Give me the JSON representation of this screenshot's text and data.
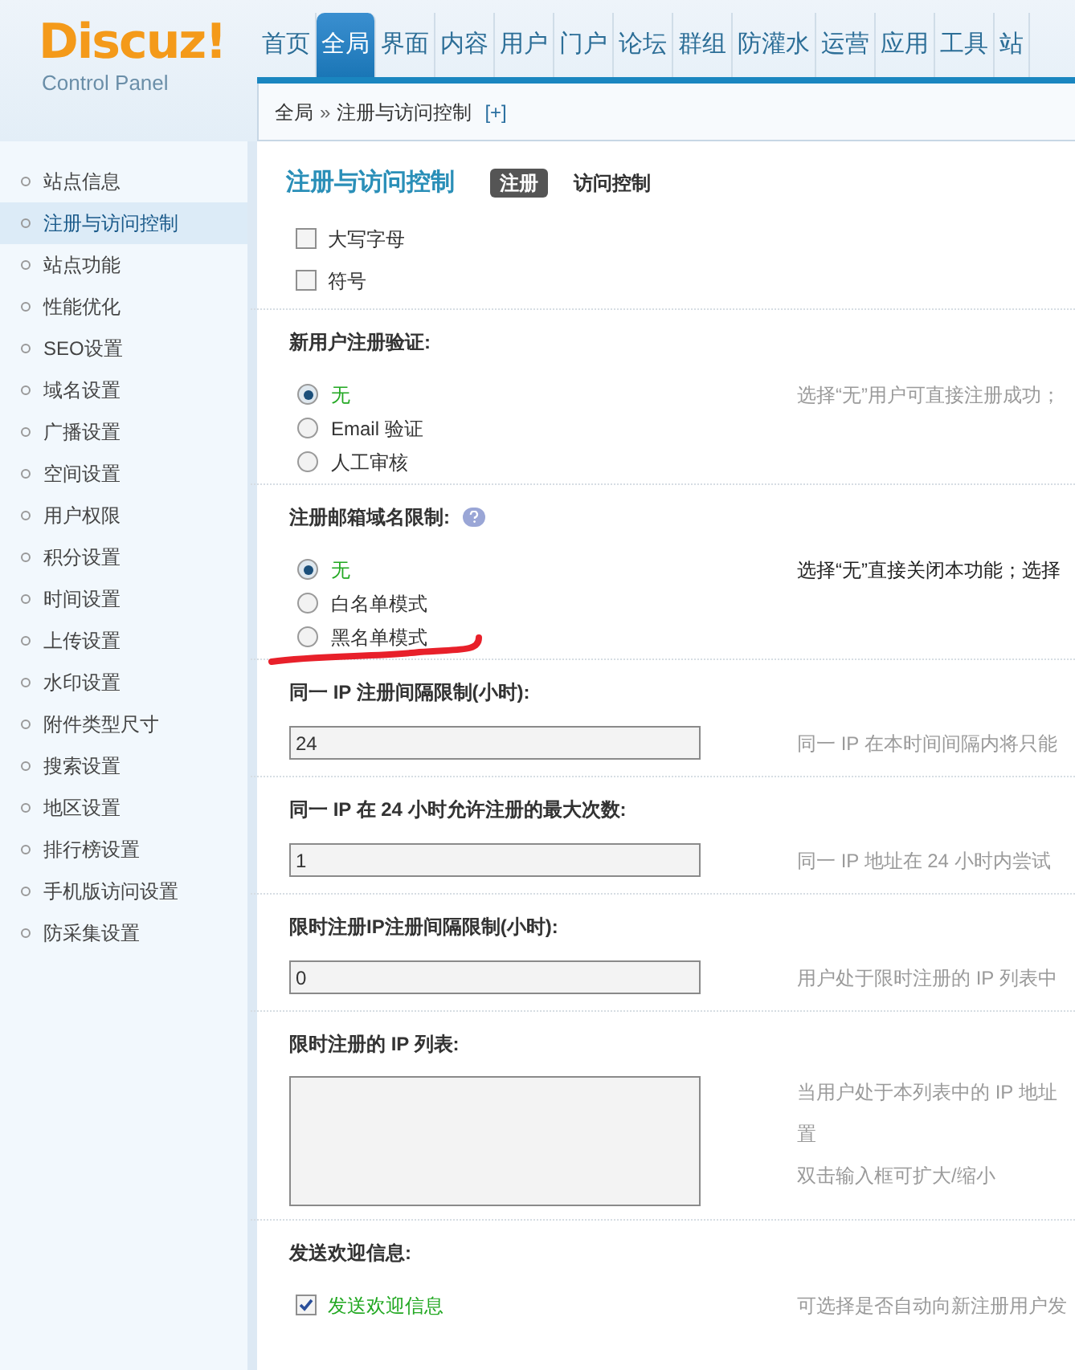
{
  "logo": {
    "brand": "Discuz!",
    "subtitle": "Control Panel"
  },
  "nav": [
    {
      "label": "首页",
      "selected": false
    },
    {
      "label": "全局",
      "selected": true
    },
    {
      "label": "界面",
      "selected": false
    },
    {
      "label": "内容",
      "selected": false
    },
    {
      "label": "用户",
      "selected": false
    },
    {
      "label": "门户",
      "selected": false
    },
    {
      "label": "论坛",
      "selected": false
    },
    {
      "label": "群组",
      "selected": false
    },
    {
      "label": "防灌水",
      "selected": false
    },
    {
      "label": "运营",
      "selected": false
    },
    {
      "label": "应用",
      "selected": false
    },
    {
      "label": "工具",
      "selected": false
    },
    {
      "label": "站",
      "selected": false
    }
  ],
  "breadcrumb": {
    "root": "全局",
    "separator": "»",
    "current": "注册与访问控制",
    "add": "[+]"
  },
  "sidebar": {
    "items": [
      {
        "label": "站点信息",
        "selected": false
      },
      {
        "label": "注册与访问控制",
        "selected": true
      },
      {
        "label": "站点功能",
        "selected": false
      },
      {
        "label": "性能优化",
        "selected": false
      },
      {
        "label": "SEO设置",
        "selected": false
      },
      {
        "label": "域名设置",
        "selected": false
      },
      {
        "label": "广播设置",
        "selected": false
      },
      {
        "label": "空间设置",
        "selected": false
      },
      {
        "label": "用户权限",
        "selected": false
      },
      {
        "label": "积分设置",
        "selected": false
      },
      {
        "label": "时间设置",
        "selected": false
      },
      {
        "label": "上传设置",
        "selected": false
      },
      {
        "label": "水印设置",
        "selected": false
      },
      {
        "label": "附件类型尺寸",
        "selected": false
      },
      {
        "label": "搜索设置",
        "selected": false
      },
      {
        "label": "地区设置",
        "selected": false
      },
      {
        "label": "排行榜设置",
        "selected": false
      },
      {
        "label": "手机版访问设置",
        "selected": false
      },
      {
        "label": "防采集设置",
        "selected": false
      }
    ]
  },
  "page": {
    "title": "注册与访问控制",
    "tabs": [
      {
        "label": "注册",
        "selected": true
      },
      {
        "label": "访问控制",
        "selected": false
      }
    ]
  },
  "settings": [
    {
      "kind": "checkboxes",
      "options": [
        {
          "label": "大写字母",
          "checked": false
        },
        {
          "label": "符号",
          "checked": false
        }
      ]
    },
    {
      "kind": "radios",
      "label": "新用户注册验证:",
      "help": false,
      "hint": "选择“无”用户可直接注册成功；",
      "hint_dark": false,
      "annotated": false,
      "options": [
        {
          "label": "无",
          "selected": true
        },
        {
          "label": "Email 验证",
          "selected": false
        },
        {
          "label": "人工审核",
          "selected": false
        }
      ]
    },
    {
      "kind": "radios",
      "label": "注册邮箱域名限制:",
      "help": true,
      "hint": "选择“无”直接关闭本功能；选择",
      "hint_dark": true,
      "annotated": true,
      "options": [
        {
          "label": "无",
          "selected": true
        },
        {
          "label": "白名单模式",
          "selected": false
        },
        {
          "label": "黑名单模式",
          "selected": false
        }
      ]
    },
    {
      "kind": "text",
      "label": "同一 IP 注册间隔限制(小时):",
      "value": "24",
      "hint": "同一 IP 在本时间间隔内将只能"
    },
    {
      "kind": "text",
      "label": "同一 IP 在 24 小时允许注册的最大次数:",
      "value": "1",
      "hint": "同一 IP 地址在 24 小时内尝试"
    },
    {
      "kind": "text",
      "label": "限时注册IP注册间隔限制(小时):",
      "value": "0",
      "hint": "用户处于限时注册的 IP 列表中"
    },
    {
      "kind": "textarea",
      "label": "限时注册的 IP 列表:",
      "hint_lines": [
        "当用户处于本列表中的 IP 地址",
        "置",
        "双击输入框可扩大/缩小"
      ]
    },
    {
      "kind": "checkbox",
      "label": "发送欢迎信息:",
      "option": {
        "label": "发送欢迎信息",
        "checked": true
      },
      "hint": "可选择是否自动向新注册用户发"
    }
  ]
}
